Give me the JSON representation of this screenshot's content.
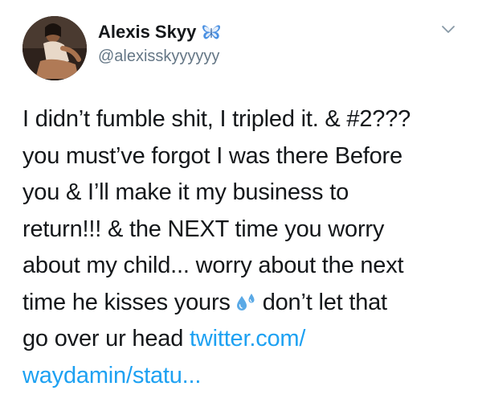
{
  "author": {
    "display_name": "Alexis Skyy",
    "handle": "@alexisskyyyyyy",
    "verified_badge_icon": "butterfly-icon"
  },
  "menu": {
    "icon": "chevron-down-icon"
  },
  "tweet": {
    "line1": "I didn’t fumble shit, I tripled it. & #2???",
    "line2": "you must’ve forgot I was there Before",
    "line3": "you & I’ll make it my business to",
    "line4": "return!!! & the NEXT time you worry",
    "line5": "about my child... worry about the next",
    "line6_before": "time he kisses yours",
    "line6_emoji": "sweat-droplets-icon",
    "line6_after": "don’t let that",
    "line7_text": "go over ur head ",
    "line7_link": "twitter.com/",
    "line8_link": "waydamin/statu..."
  },
  "colors": {
    "text": "#14171a",
    "secondary": "#657786",
    "link": "#1da1f2",
    "butterfly": "#4a90e2"
  }
}
